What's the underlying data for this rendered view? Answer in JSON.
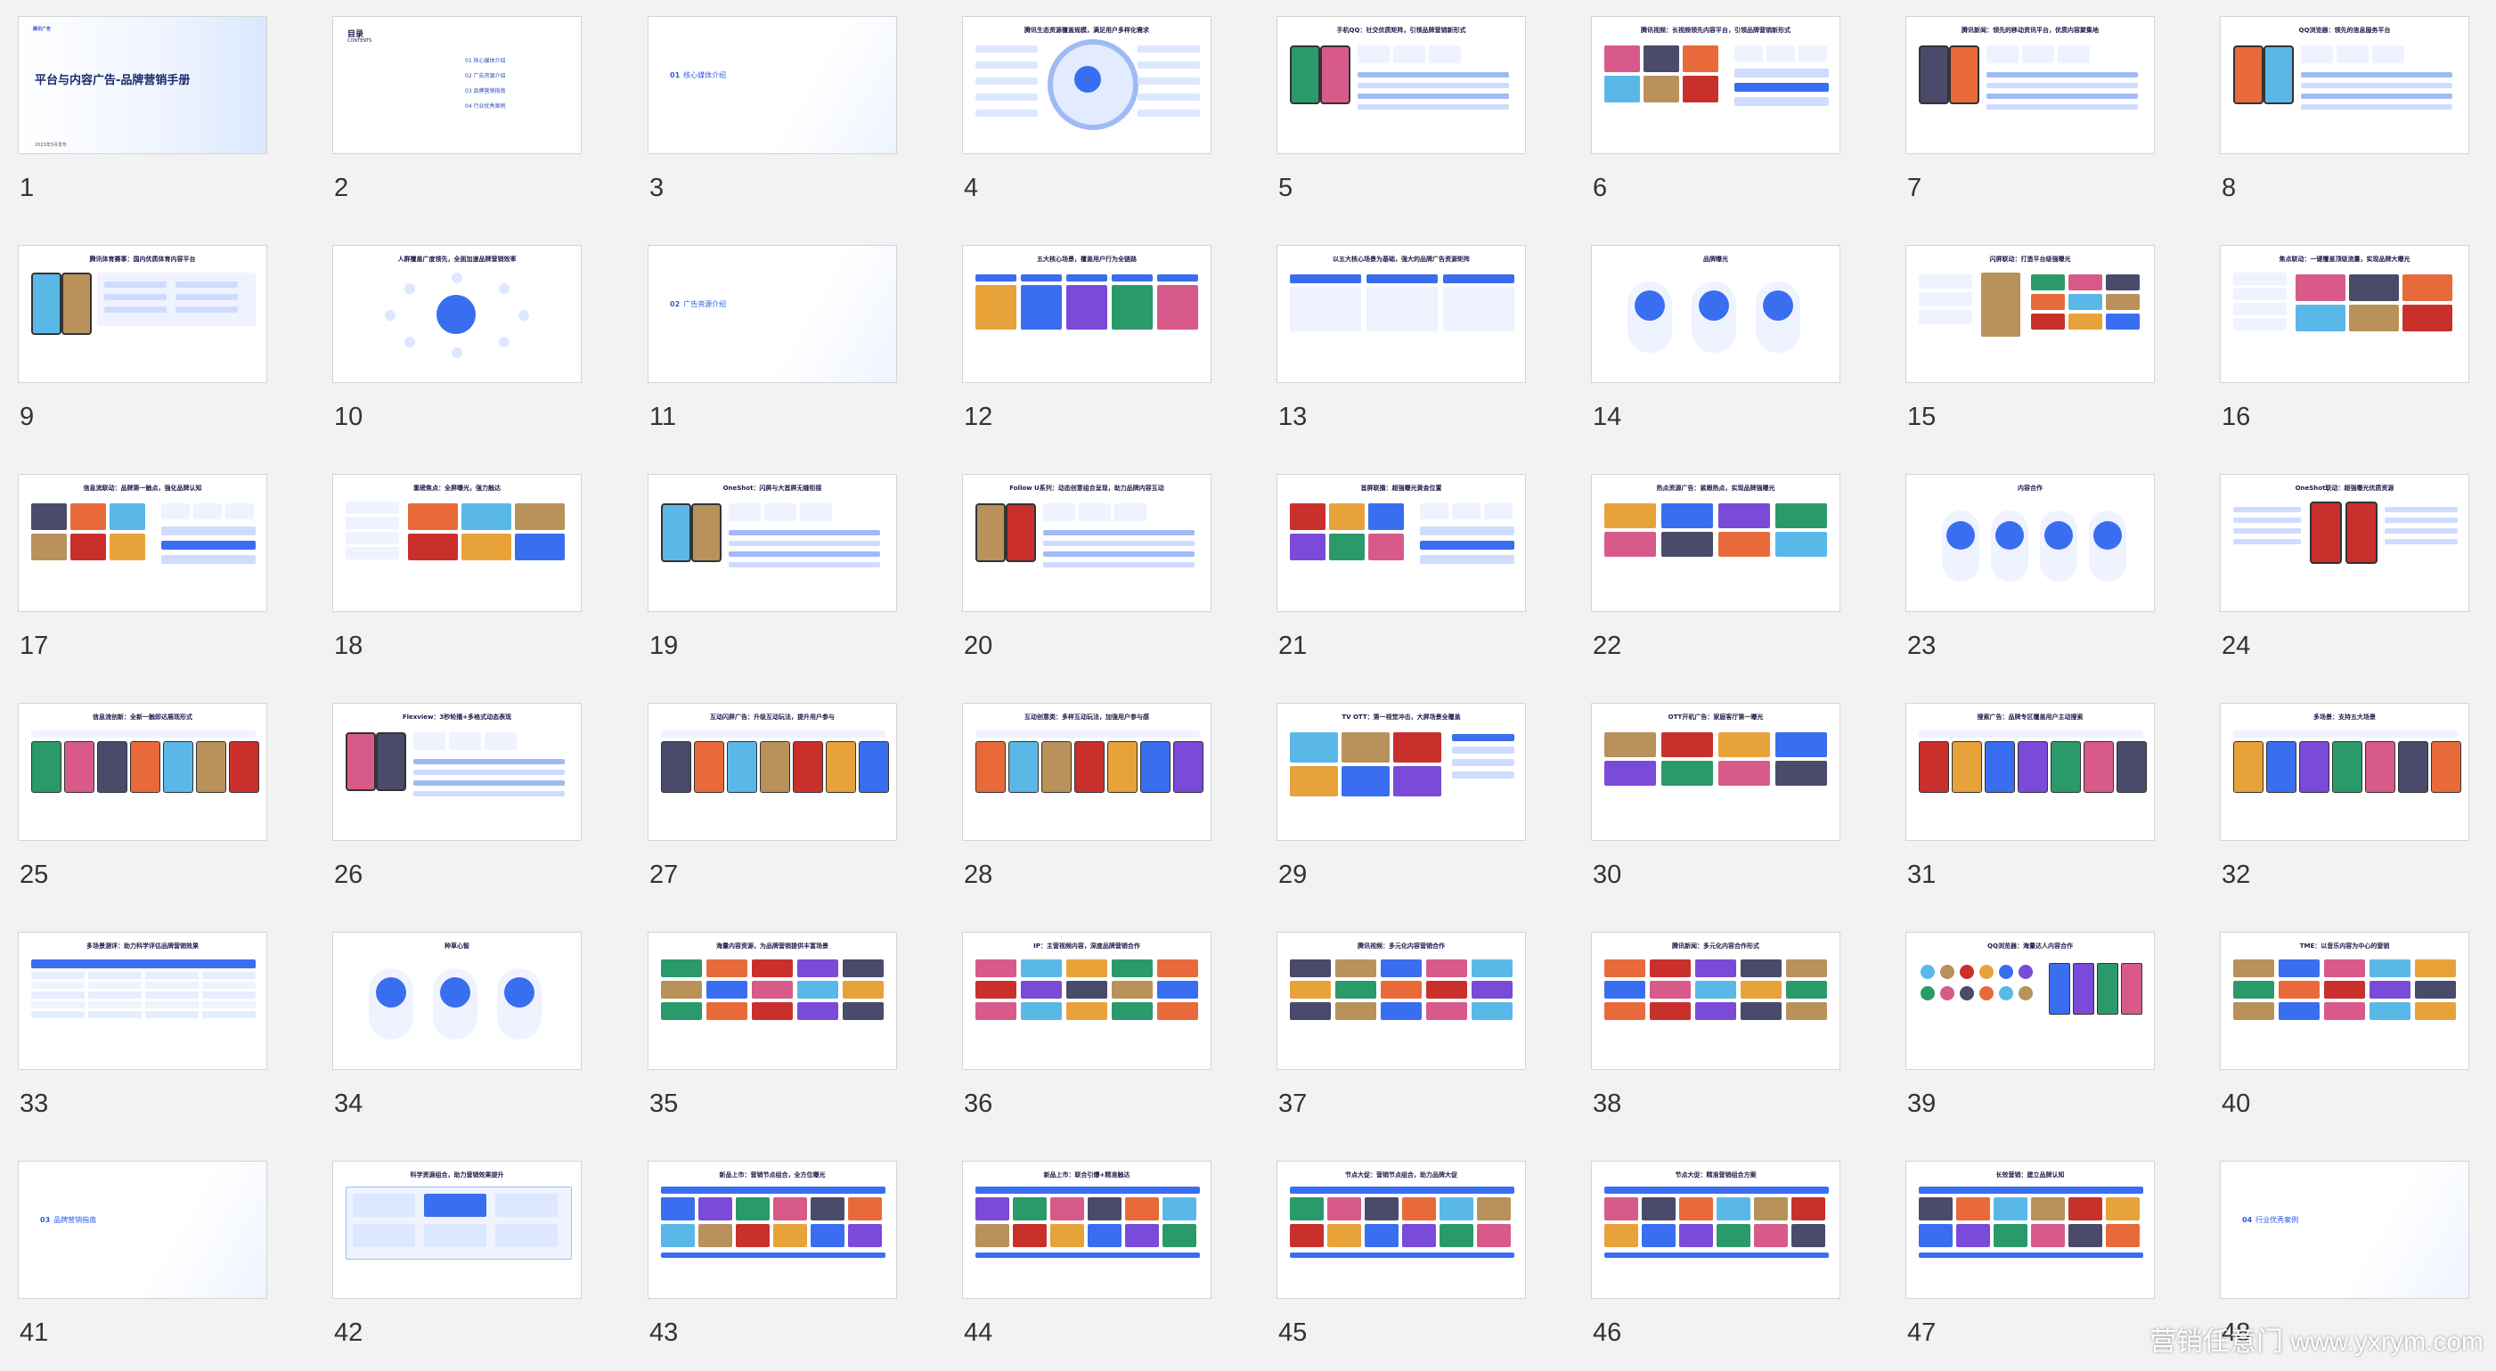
{
  "slides": [
    {
      "n": "1",
      "type": "cover",
      "title": "平台与内容广告-品牌营销手册",
      "sub": "",
      "foot": "2023年5月发布"
    },
    {
      "n": "2",
      "type": "toc",
      "head": "目录",
      "head2": "CONTENTS",
      "items": [
        "01 核心媒体介绍",
        "02 广告资源介绍",
        "03 品牌营销指南",
        "04 行业优秀案例"
      ]
    },
    {
      "n": "3",
      "type": "section",
      "label_num": "01",
      "label": "核心媒体介绍"
    },
    {
      "n": "4",
      "type": "content",
      "title": "腾讯生态资源覆盖规模，满足用户多样化需求",
      "layout": "radial"
    },
    {
      "n": "5",
      "type": "content",
      "title": "手机QQ：社交优质矩阵，引领品牌营销新形式",
      "layout": "phones-stats"
    },
    {
      "n": "6",
      "type": "content",
      "title": "腾讯视频：长视频领先内容平台，引领品牌营销新形式",
      "layout": "screens-stats"
    },
    {
      "n": "7",
      "type": "content",
      "title": "腾讯新闻：领先的移动资讯平台，优质内容聚集地",
      "layout": "phones-stats"
    },
    {
      "n": "8",
      "type": "content",
      "title": "QQ浏览器：领先的信息服务平台",
      "layout": "phones-stats"
    },
    {
      "n": "9",
      "type": "content",
      "title": "腾讯体育赛事：国内优质体育内容平台",
      "layout": "phones-list"
    },
    {
      "n": "10",
      "type": "content",
      "title": "人群覆盖广度领先，全面加速品牌营销效率",
      "layout": "network"
    },
    {
      "n": "11",
      "type": "section",
      "label_num": "02",
      "label": "广告资源介绍"
    },
    {
      "n": "12",
      "type": "content",
      "title": "五大核心场景，覆盖用户行为全链路",
      "layout": "five-cols"
    },
    {
      "n": "13",
      "type": "content",
      "title": "以五大核心场景为基础，强大的品牌广告资源矩阵",
      "layout": "three-panels"
    },
    {
      "n": "14",
      "type": "content",
      "title": "品牌曝光",
      "layout": "three-circles"
    },
    {
      "n": "15",
      "type": "content",
      "title": "闪屏联动：打造平台级强曝光",
      "layout": "stats-gold"
    },
    {
      "n": "16",
      "type": "content",
      "title": "焦点联动：一键覆盖顶级流量，实现品牌大曝光",
      "layout": "stats-screens"
    },
    {
      "n": "17",
      "type": "content",
      "title": "信息流联动：品牌第一触点，强化品牌认知",
      "layout": "screens-stats"
    },
    {
      "n": "18",
      "type": "content",
      "title": "重磅焦点：全屏曝光，强力触达",
      "layout": "stats-phones"
    },
    {
      "n": "19",
      "type": "content",
      "title": "OneShot：闪屏与大首屏无缝衔接",
      "layout": "phones-stats"
    },
    {
      "n": "20",
      "type": "content",
      "title": "Follow U系列：动态创意组合呈现，助力品牌内容互动",
      "layout": "phones-stats"
    },
    {
      "n": "21",
      "type": "content",
      "title": "首屏联播：超强曝光黄金位置",
      "layout": "screens-stats"
    },
    {
      "n": "22",
      "type": "content",
      "title": "热点资源广告：紧跟热点，实现品牌强曝光",
      "layout": "screens-grid"
    },
    {
      "n": "23",
      "type": "content",
      "title": "内容合作",
      "layout": "four-circles"
    },
    {
      "n": "24",
      "type": "content",
      "title": "OneShot联动：超强曝光优质资源",
      "layout": "phones-red"
    },
    {
      "n": "25",
      "type": "content",
      "title": "信息流创新：全新一触即达展现形式",
      "layout": "phones-row"
    },
    {
      "n": "26",
      "type": "content",
      "title": "Flexview：3秒轮播+多格式动态表现",
      "layout": "phones-stats"
    },
    {
      "n": "27",
      "type": "content",
      "title": "互动闪屏广告：升级互动玩法，提升用户参与",
      "layout": "phones-row"
    },
    {
      "n": "28",
      "type": "content",
      "title": "互动创意类：多样互动玩法，加强用户参与感",
      "layout": "phones-row"
    },
    {
      "n": "29",
      "type": "content",
      "title": "TV OTT：第一视觉冲击，大屏场景全覆盖",
      "layout": "tv-grid"
    },
    {
      "n": "30",
      "type": "content",
      "title": "OTT开机广告：家庭客厅第一曝光",
      "layout": "screens-grid"
    },
    {
      "n": "31",
      "type": "content",
      "title": "搜索广告：品牌专区覆盖用户主动搜索",
      "layout": "phones-row"
    },
    {
      "n": "32",
      "type": "content",
      "title": "多场景：支持五大场景",
      "layout": "phones-row"
    },
    {
      "n": "33",
      "type": "content",
      "title": "多场景测评：助力科学评估品牌营销效果",
      "layout": "table"
    },
    {
      "n": "34",
      "type": "content",
      "title": "种草心智",
      "layout": "three-circles"
    },
    {
      "n": "35",
      "type": "content",
      "title": "海量内容资源，为品牌营销提供丰富场景",
      "layout": "image-grid"
    },
    {
      "n": "36",
      "type": "content",
      "title": "IP：主营视频内容，深度品牌营销合作",
      "layout": "image-grid"
    },
    {
      "n": "37",
      "type": "content",
      "title": "腾讯视频：多元化内容营销合作",
      "layout": "image-grid"
    },
    {
      "n": "38",
      "type": "content",
      "title": "腾讯新闻：多元化内容合作形式",
      "layout": "image-grid"
    },
    {
      "n": "39",
      "type": "content",
      "title": "QQ浏览器：海量达人内容合作",
      "layout": "avatars"
    },
    {
      "n": "40",
      "type": "content",
      "title": "TME：以音乐内容为中心的营销",
      "layout": "image-grid"
    },
    {
      "n": "41",
      "type": "section",
      "label_num": "03",
      "label": "品牌营销指南"
    },
    {
      "n": "42",
      "type": "content",
      "title": "科学资源组合，助力营销效果提升",
      "layout": "diagram"
    },
    {
      "n": "43",
      "type": "content",
      "title": "新品上市：营销节点组合，全方位曝光",
      "layout": "bands"
    },
    {
      "n": "44",
      "type": "content",
      "title": "新品上市：联合引爆+精准触达",
      "layout": "bands"
    },
    {
      "n": "45",
      "type": "content",
      "title": "节点大促：营销节点组合，助力品牌大促",
      "layout": "bands"
    },
    {
      "n": "46",
      "type": "content",
      "title": "节点大促：精准营销组合方案",
      "layout": "bands"
    },
    {
      "n": "47",
      "type": "content",
      "title": "长效营销：建立品牌认知",
      "layout": "bands"
    },
    {
      "n": "48",
      "type": "section",
      "label_num": "04",
      "label": "行业优秀案例"
    }
  ],
  "watermark": "营销任意门 www.yxrym.com",
  "colors": {
    "accent": "#3a6ef0",
    "dark": "#1a1a4a",
    "bg": "#f2f2f2"
  }
}
